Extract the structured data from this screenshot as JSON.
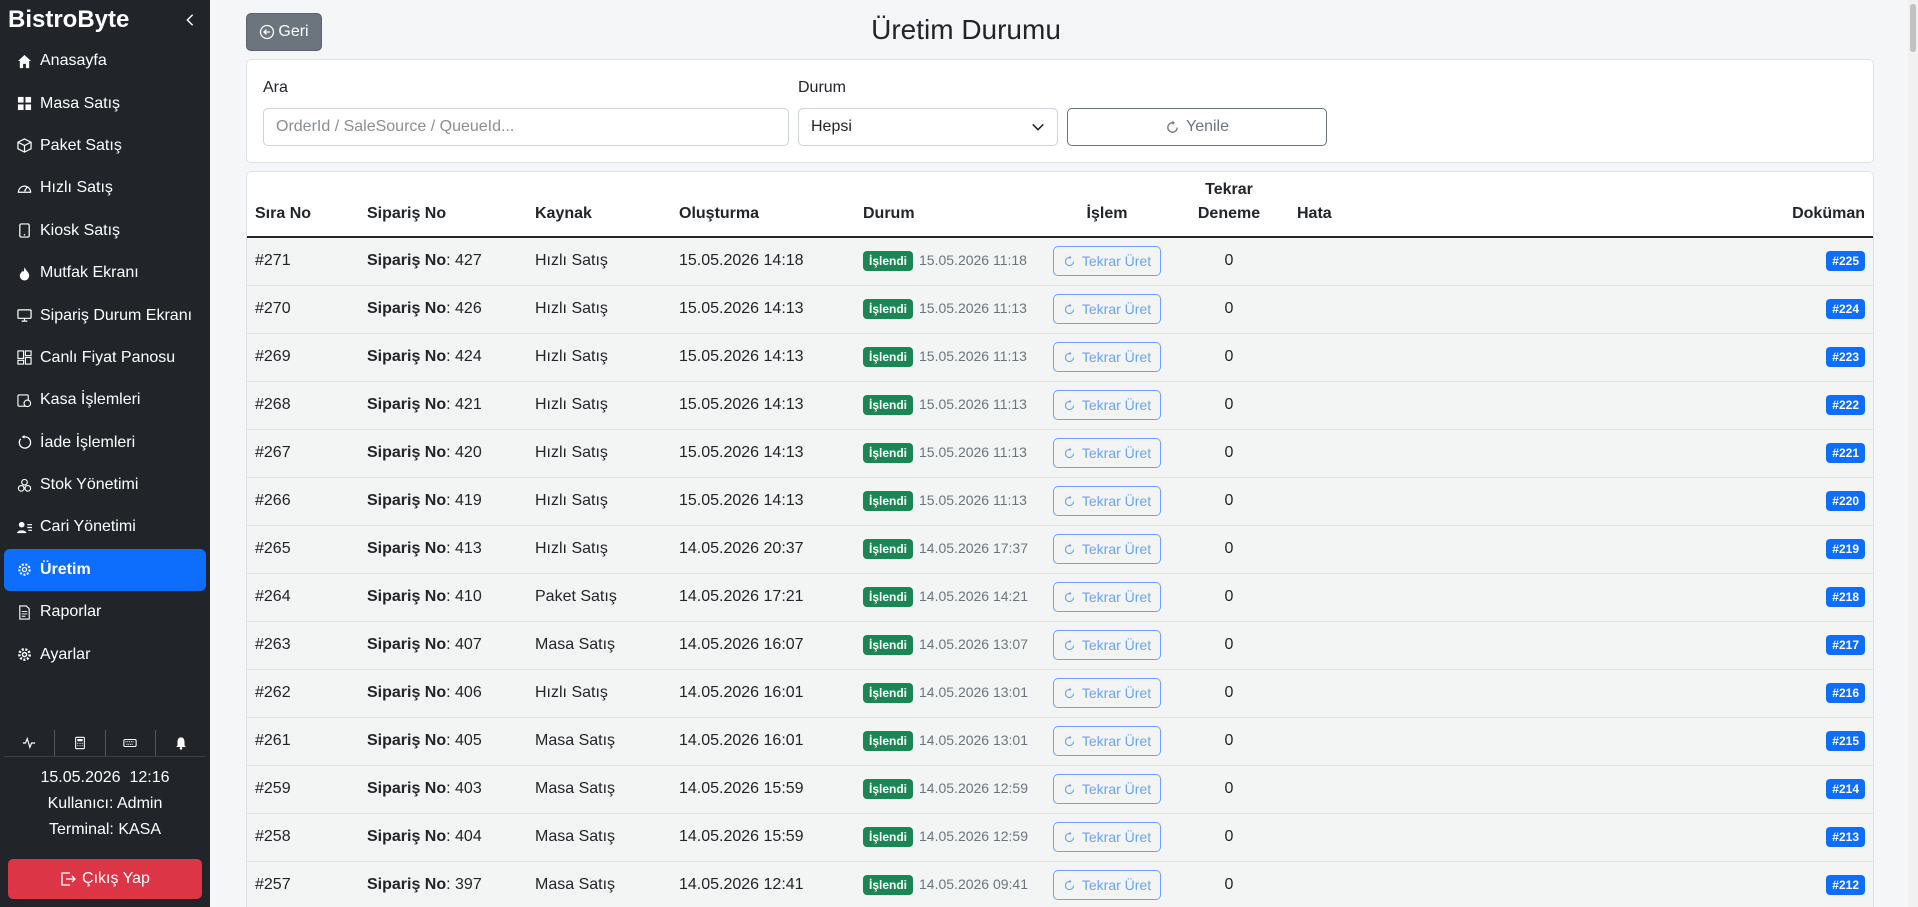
{
  "app": {
    "brand": "BistroByte"
  },
  "sidebar": {
    "items": [
      {
        "label": "Anasayfa",
        "icon": "home-icon"
      },
      {
        "label": "Masa Satış",
        "icon": "grid-icon"
      },
      {
        "label": "Paket Satış",
        "icon": "box-icon"
      },
      {
        "label": "Hızlı Satış",
        "icon": "speedometer-icon"
      },
      {
        "label": "Kiosk Satış",
        "icon": "tablet-icon"
      },
      {
        "label": "Mutfak Ekranı",
        "icon": "fire-icon"
      },
      {
        "label": "Sipariş Durum Ekranı",
        "icon": "monitor-icon"
      },
      {
        "label": "Canlı Fiyat Panosu",
        "icon": "dashboard-icon"
      },
      {
        "label": "Kasa İşlemleri",
        "icon": "cashbox-icon"
      },
      {
        "label": "İade İşlemleri",
        "icon": "return-icon"
      },
      {
        "label": "Stok Yönetimi",
        "icon": "boxes-icon"
      },
      {
        "label": "Cari Yönetimi",
        "icon": "person-lines-icon"
      },
      {
        "label": "Üretim",
        "icon": "gear-icon",
        "active": true
      },
      {
        "label": "Raporlar",
        "icon": "document-icon"
      },
      {
        "label": "Ayarlar",
        "icon": "settings-icon"
      }
    ],
    "datetime": "15.05.2026  12:16",
    "user": "Kullanıcı: Admin",
    "terminal": "Terminal: KASA",
    "logout_label": "Çıkış Yap"
  },
  "header": {
    "back_label": "Geri",
    "title": "Üretim Durumu"
  },
  "filters": {
    "search_label": "Ara",
    "search_placeholder": "OrderId / SaleSource / QueueId...",
    "status_label": "Durum",
    "status_value": "Hepsi",
    "refresh_label": "Yenile"
  },
  "table": {
    "headers": {
      "seq": "Sıra No",
      "order": "Sipariş No",
      "source": "Kaynak",
      "created": "Oluşturma",
      "status": "Durum",
      "action": "İşlem",
      "retry_line1": "Tekrar",
      "retry_line2": "Deneme",
      "error": "Hata",
      "doc": "Doküman"
    },
    "order_prefix": "Sipariş No",
    "status_text": "İşlendi",
    "action_label": "Tekrar Üret",
    "rows": [
      {
        "seq": "#271",
        "order": ": 427",
        "source": "Hızlı Satış",
        "created": "15.05.2026 14:18",
        "ts": "15.05.2026 11:18",
        "retry": "0",
        "error": "",
        "doc": "#225"
      },
      {
        "seq": "#270",
        "order": ": 426",
        "source": "Hızlı Satış",
        "created": "15.05.2026 14:13",
        "ts": "15.05.2026 11:13",
        "retry": "0",
        "error": "",
        "doc": "#224"
      },
      {
        "seq": "#269",
        "order": ": 424",
        "source": "Hızlı Satış",
        "created": "15.05.2026 14:13",
        "ts": "15.05.2026 11:13",
        "retry": "0",
        "error": "",
        "doc": "#223"
      },
      {
        "seq": "#268",
        "order": ": 421",
        "source": "Hızlı Satış",
        "created": "15.05.2026 14:13",
        "ts": "15.05.2026 11:13",
        "retry": "0",
        "error": "",
        "doc": "#222"
      },
      {
        "seq": "#267",
        "order": ": 420",
        "source": "Hızlı Satış",
        "created": "15.05.2026 14:13",
        "ts": "15.05.2026 11:13",
        "retry": "0",
        "error": "",
        "doc": "#221"
      },
      {
        "seq": "#266",
        "order": ": 419",
        "source": "Hızlı Satış",
        "created": "15.05.2026 14:13",
        "ts": "15.05.2026 11:13",
        "retry": "0",
        "error": "",
        "doc": "#220"
      },
      {
        "seq": "#265",
        "order": ": 413",
        "source": "Hızlı Satış",
        "created": "14.05.2026 20:37",
        "ts": "14.05.2026 17:37",
        "retry": "0",
        "error": "",
        "doc": "#219"
      },
      {
        "seq": "#264",
        "order": ": 410",
        "source": "Paket Satış",
        "created": "14.05.2026 17:21",
        "ts": "14.05.2026 14:21",
        "retry": "0",
        "error": "",
        "doc": "#218"
      },
      {
        "seq": "#263",
        "order": ": 407",
        "source": "Masa Satış",
        "created": "14.05.2026 16:07",
        "ts": "14.05.2026 13:07",
        "retry": "0",
        "error": "",
        "doc": "#217"
      },
      {
        "seq": "#262",
        "order": ": 406",
        "source": "Hızlı Satış",
        "created": "14.05.2026 16:01",
        "ts": "14.05.2026 13:01",
        "retry": "0",
        "error": "",
        "doc": "#216"
      },
      {
        "seq": "#261",
        "order": ": 405",
        "source": "Masa Satış",
        "created": "14.05.2026 16:01",
        "ts": "14.05.2026 13:01",
        "retry": "0",
        "error": "",
        "doc": "#215"
      },
      {
        "seq": "#259",
        "order": ": 403",
        "source": "Masa Satış",
        "created": "14.05.2026 15:59",
        "ts": "14.05.2026 12:59",
        "retry": "0",
        "error": "",
        "doc": "#214"
      },
      {
        "seq": "#258",
        "order": ": 404",
        "source": "Masa Satış",
        "created": "14.05.2026 15:59",
        "ts": "14.05.2026 12:59",
        "retry": "0",
        "error": "",
        "doc": "#213"
      },
      {
        "seq": "#257",
        "order": ": 397",
        "source": "Masa Satış",
        "created": "14.05.2026 12:41",
        "ts": "14.05.2026 09:41",
        "retry": "0",
        "error": "",
        "doc": "#212"
      }
    ]
  },
  "colors": {
    "sidebar_bg": "#212529",
    "accent": "#0d6efd",
    "success": "#198754",
    "danger": "#dc3545"
  }
}
